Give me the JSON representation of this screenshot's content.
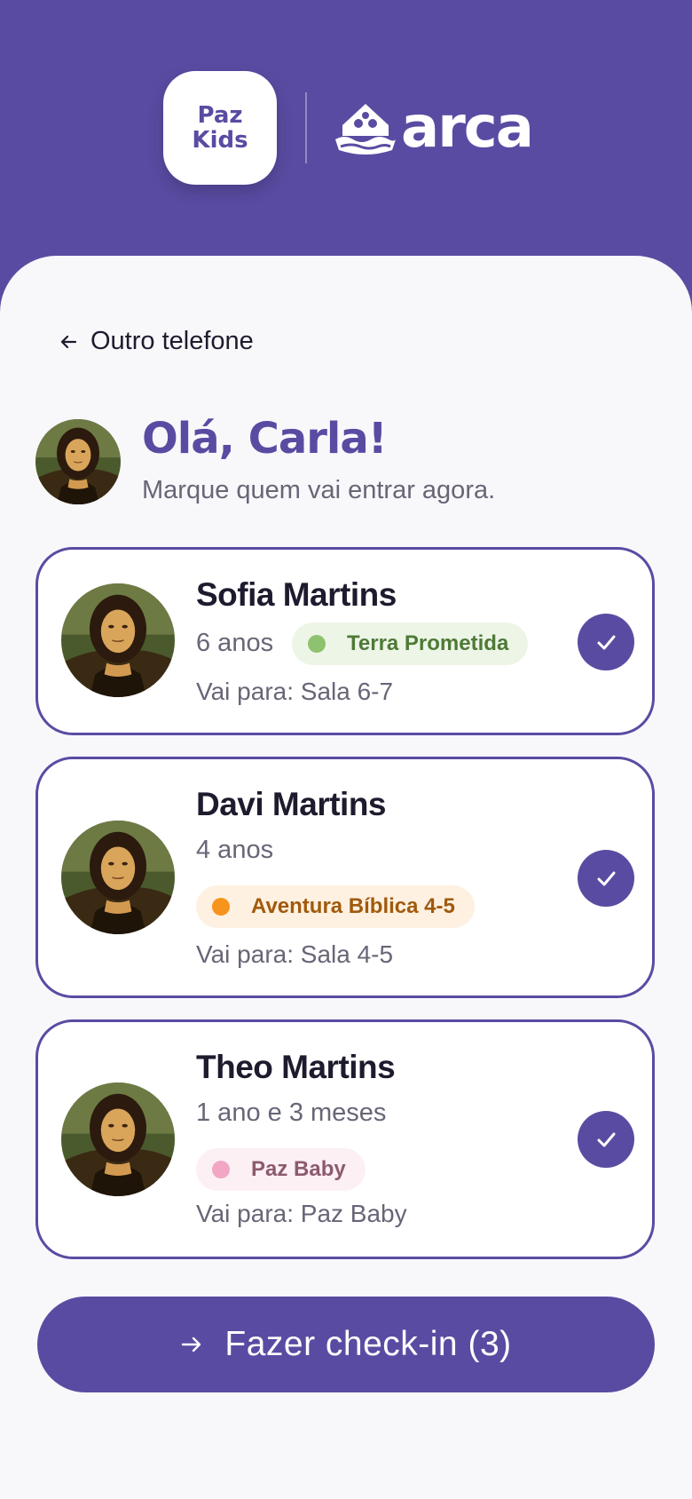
{
  "header": {
    "badge_line1": "Paz",
    "badge_line2": "Kids",
    "partner_logo_text": "arca"
  },
  "nav": {
    "back_label": "Outro telefone"
  },
  "greeting": {
    "title": "Olá, Carla!",
    "subtitle": "Marque quem vai entrar agora."
  },
  "children": [
    {
      "name": "Sofia Martins",
      "age": "6 anos",
      "group": "Terra Prometida",
      "group_color": "#8fc26f",
      "group_bg": "#edf5e7",
      "group_text_color": "#4e7a37",
      "destination": "Vai para: Sala 6-7",
      "checked": true
    },
    {
      "name": "Davi Martins",
      "age": "4 anos",
      "group": "Aventura Bíblica 4-5",
      "group_color": "#f7941d",
      "group_bg": "#fff1e1",
      "group_text_color": "#a05a0c",
      "destination": "Vai para: Sala 4-5",
      "checked": true
    },
    {
      "name": "Theo Martins",
      "age": "1 ano e 3 meses",
      "group": "Paz Baby",
      "group_color": "#f2a6c4",
      "group_bg": "#fdf0f5",
      "group_text_color": "#8c5a6e",
      "destination": "Vai para: Paz Baby",
      "checked": true
    }
  ],
  "cta": {
    "label": "Fazer check-in (3)"
  },
  "colors": {
    "brand": "#5a4ba2",
    "background": "#f8f8fb"
  }
}
